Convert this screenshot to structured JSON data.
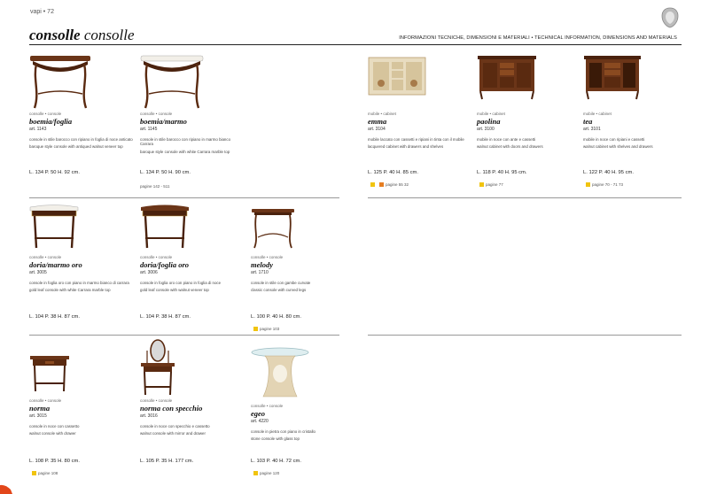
{
  "header": {
    "page_label": "vapi • 72",
    "title_bold": "consolle",
    "title_regular": " consolle",
    "info": "INFORMAZIONI TECNICHE, DIMENSIONI E MATERIALI • TECHNICAL INFORMATION, DIMENSIONS AND MATERIALS"
  },
  "colors": {
    "wood": "#6b3518",
    "wood_dark": "#4a220e",
    "marble": "#f2efe8",
    "cream": "#e8dcc0",
    "gold": "#c9a64a",
    "swatch_yellow": "#f1c40f",
    "swatch_orange": "#e67e22"
  },
  "products": [
    {
      "id": "boemia-foglia",
      "sku": "consolle • console",
      "name": "boemia/foglia",
      "art": "art. 1143",
      "desc_it": "console in stile barocco con ripiano in foglia di noce anticato",
      "desc_en": "baroque style console with antiqued walnut veneer top",
      "dims": "L. 134  P. 50  H. 92 cm.",
      "pages": ""
    },
    {
      "id": "boemia-marmo",
      "sku": "consolle • console",
      "name": "boemia/marmo",
      "art": "art. 1145",
      "desc_it": "console in stile barocco con ripiano in marmo bianco Carrara",
      "desc_en": "baroque style console with white Carrara marble top",
      "dims": "L. 134  P. 50  H. 90 cm.",
      "pages": "pagine  142 - 511"
    },
    {
      "id": "emma",
      "sku": "mobile • cabinet",
      "name": "emma",
      "art": "art. 3104",
      "desc_it": "mobile laccato con cassetti e ripiani in tinta con il mobile",
      "desc_en": "lacquered cabinet with drawers and shelves",
      "dims": "L. 125  P. 40  H. 85 cm.",
      "pages": "pagine  55  32"
    },
    {
      "id": "paolina",
      "sku": "mobile • cabinet",
      "name": "paolina",
      "art": "art. 3100",
      "desc_it": "mobile in noce con ante e cassetti",
      "desc_en": "walnut cabinet with doors and drawers",
      "dims": "L. 118  P. 40  H. 95 cm.",
      "pages": "pagine  77"
    },
    {
      "id": "tea",
      "sku": "mobile • cabinet",
      "name": "tea",
      "art": "art. 3101",
      "desc_it": "mobile in noce con ripiani e cassetti",
      "desc_en": "walnut cabinet with shelves and drawers",
      "dims": "L. 122  P. 40  H. 95 cm.",
      "pages": "pagine  70 - 71  73"
    },
    {
      "id": "doria-marmo-oro",
      "sku": "consolle • console",
      "name": "doria/marmo oro",
      "art": "art. 3005",
      "desc_it": "console in foglia oro con piano in marmo bianco di carrara",
      "desc_en": "gold leaf console with white Carrara marble top",
      "dims": "L. 104  P. 38  H. 87 cm.",
      "pages": ""
    },
    {
      "id": "doria-foglia-oro",
      "sku": "consolle • console",
      "name": "doria/foglia oro",
      "art": "art. 3006",
      "desc_it": "console in foglia oro con piano in foglia di noce",
      "desc_en": "gold leaf console with walnut veneer top",
      "dims": "L. 104  P. 38  H. 87 cm.",
      "pages": ""
    },
    {
      "id": "melody",
      "sku": "consolle • console",
      "name": "melody",
      "art": "art. 1710",
      "desc_it": "console in stile con gambe curvate",
      "desc_en": "classic console with curved legs",
      "dims": "L. 100  P. 40  H. 80 cm.",
      "pages": "pagine  103"
    },
    {
      "id": "norma",
      "sku": "consolle • console",
      "name": "norma",
      "art": "art. 3015",
      "desc_it": "console in noce con cassetto",
      "desc_en": "walnut console with drawer",
      "dims": "L. 108  P. 35  H. 80 cm.",
      "pages": "pagine  108"
    },
    {
      "id": "norma-specchio",
      "sku": "consolle • console",
      "name": "norma con specchio",
      "art": "art. 3016",
      "desc_it": "console in noce con specchio e cassetto",
      "desc_en": "walnut console with mirror and drawer",
      "dims": "L. 105  P. 35  H. 177 cm.",
      "pages": ""
    },
    {
      "id": "egeo",
      "sku": "consolle • console",
      "name": "egeo",
      "art": "art. 4220",
      "desc_it": "console in pietra con piano in cristallo",
      "desc_en": "stone console with glass top",
      "dims": "L. 103  P. 40  H. 72 cm.",
      "pages": "pagine  120"
    }
  ]
}
